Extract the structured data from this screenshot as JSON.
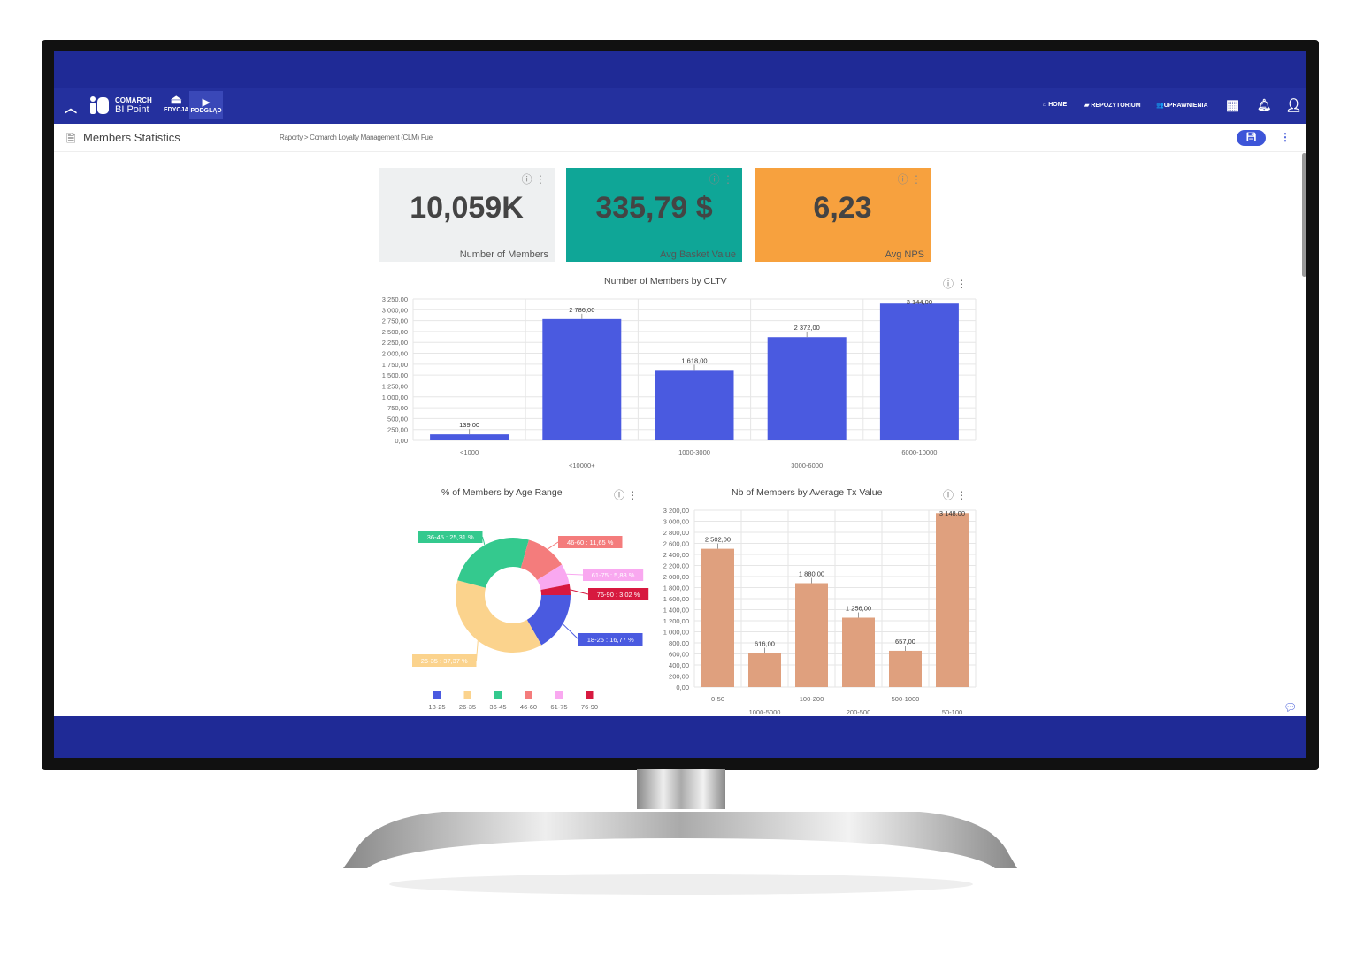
{
  "nav": {
    "logo_top": "COMARCH",
    "logo_bottom": "BI Point",
    "edit": "EDYCJA",
    "preview": "PODGLĄD",
    "home": "HOME",
    "repo": "REPOZYTORIUM",
    "perm": "UPRAWNIENIA"
  },
  "page": {
    "title": "Members Statistics",
    "breadcrumb": "Raporty > Comarch Loyalty Management (CLM) Fuel"
  },
  "kpis": [
    {
      "value": "10,059K",
      "label": "Number of Members",
      "bg": "#eef0f1"
    },
    {
      "value": "335,79 $",
      "label": "Avg Basket Value",
      "bg": "#0fa697"
    },
    {
      "value": "6,23",
      "label": "Avg NPS",
      "bg": "#f7a13e"
    }
  ],
  "chart_data": [
    {
      "type": "bar",
      "title": "Number of Members by CLTV",
      "categories": [
        "<1000",
        "<10000+",
        "1000-3000",
        "3000-6000",
        "6000-10000"
      ],
      "values": [
        139,
        2786,
        1618,
        2372,
        3144
      ],
      "labels": [
        "139,00",
        "2 786,00",
        "1 618,00",
        "2 372,00",
        "3 144,00"
      ],
      "ylim": [
        0,
        3250
      ],
      "yticks": [
        "0,00",
        "250,00",
        "500,00",
        "750,00",
        "1 000,00",
        "1 250,00",
        "1 500,00",
        "1 750,00",
        "2 000,00",
        "2 250,00",
        "2 500,00",
        "2 750,00",
        "3 000,00",
        "3 250,00"
      ],
      "color": "#4a5ae0",
      "grid": true
    },
    {
      "type": "pie",
      "title": "% of Members by Age Range",
      "categories": [
        "18-25",
        "26-35",
        "36-45",
        "46-60",
        "61-75",
        "76-90"
      ],
      "values": [
        16.77,
        37.37,
        25.31,
        11.65,
        5.88,
        3.02
      ],
      "labels": [
        "18-25 : 16,77 %",
        "26-35 : 37,37 %",
        "36-45 : 25,31 %",
        "46-60 : 11,65 %",
        "61-75 : 5,88 %",
        "76-90 : 3,02 %"
      ],
      "colors": [
        "#4a5ae0",
        "#fbd38d",
        "#34c98e",
        "#f47c7c",
        "#f9a8f0",
        "#d7193f"
      ],
      "legend": "bottom"
    },
    {
      "type": "bar",
      "title": "Nb of Members by Average Tx Value",
      "categories": [
        "0-50",
        "1000-5000",
        "100-200",
        "200-500",
        "500-1000",
        "50-100"
      ],
      "values": [
        2502,
        616,
        1880,
        1256,
        657,
        3148
      ],
      "labels": [
        "2 502,00",
        "616,00",
        "1 880,00",
        "1 256,00",
        "657,00",
        "3 148,00"
      ],
      "ylim": [
        0,
        3200
      ],
      "yticks": [
        "0,00",
        "200,00",
        "400,00",
        "600,00",
        "800,00",
        "1 000,00",
        "1 200,00",
        "1 400,00",
        "1 600,00",
        "1 800,00",
        "2 000,00",
        "2 200,00",
        "2 400,00",
        "2 600,00",
        "2 800,00",
        "3 000,00",
        "3 200,00"
      ],
      "color": "#dfa07e",
      "grid": true
    }
  ]
}
